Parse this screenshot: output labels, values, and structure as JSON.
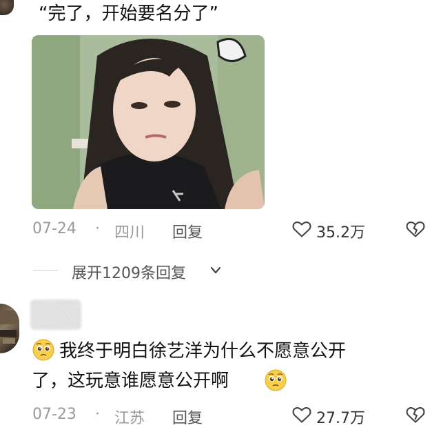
{
  "comment1": {
    "text": "“完了，开始要名分了”",
    "date": "07-24",
    "separator": "·",
    "location": "四川",
    "reply_label": "回复",
    "likes": "35.2万"
  },
  "replies_toggle": {
    "label": "展开1209条回复"
  },
  "comment2": {
    "line1": "我终于明白徐艺洋为什么不愿意公开",
    "line2": "了，这玩意谁愿意公开啊",
    "date": "07-23",
    "separator": "·",
    "location": "江苏",
    "reply_label": "回复",
    "likes": "27.7万"
  },
  "icons": {
    "like": "heart-outline-icon",
    "dislike": "broken-heart-icon",
    "expand": "chevron-down-icon",
    "emoji": "pleading-face-emoji"
  },
  "colors": {
    "meta_gray": "#9a9a9a",
    "text": "#111111"
  }
}
